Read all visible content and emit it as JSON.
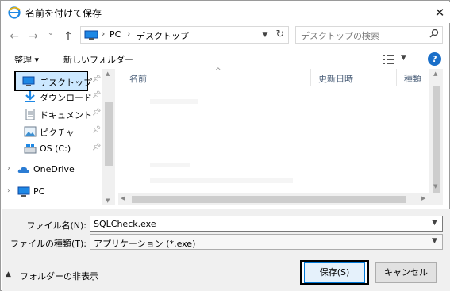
{
  "window": {
    "title": "名前を付けて保存",
    "close": "✕"
  },
  "nav": {
    "back_icon": "←",
    "forward_icon": "→",
    "recent_icon": "⌄",
    "up_icon": "↑",
    "address_parts": [
      "PC",
      "デスクトップ"
    ],
    "search_placeholder": "デスクトップの検索"
  },
  "toolbar": {
    "organize": "整理 ▾",
    "new_folder": "新しいフォルダー"
  },
  "sidebar": {
    "items": [
      {
        "label": "デスクトップ",
        "icon": "desktop-icon",
        "pinned": true,
        "selected": true
      },
      {
        "label": "ダウンロード",
        "icon": "download-icon",
        "pinned": true
      },
      {
        "label": "ドキュメント",
        "icon": "document-icon",
        "pinned": true
      },
      {
        "label": "ピクチャ",
        "icon": "picture-icon",
        "pinned": true
      },
      {
        "label": "OS (C:)",
        "icon": "drive-icon",
        "pinned": true
      },
      {
        "label": "OneDrive",
        "icon": "cloud-icon"
      },
      {
        "label": "PC",
        "icon": "pc-icon"
      }
    ]
  },
  "filelist": {
    "columns": [
      "名前",
      "更新日時",
      "種類"
    ]
  },
  "form": {
    "filename_label": "ファイル名(N):",
    "filename_value": "SQLCheck.exe",
    "filetype_label": "ファイルの種類(T):",
    "filetype_value": "アプリケーション (*.exe)"
  },
  "footer": {
    "hide_folders": "フォルダーの非表示",
    "save": "保存(S)",
    "cancel": "キャンセル"
  },
  "colors": {
    "accent": "#1a6fc9",
    "selection": "#cce8ff",
    "panel": "#f0f0f0"
  }
}
